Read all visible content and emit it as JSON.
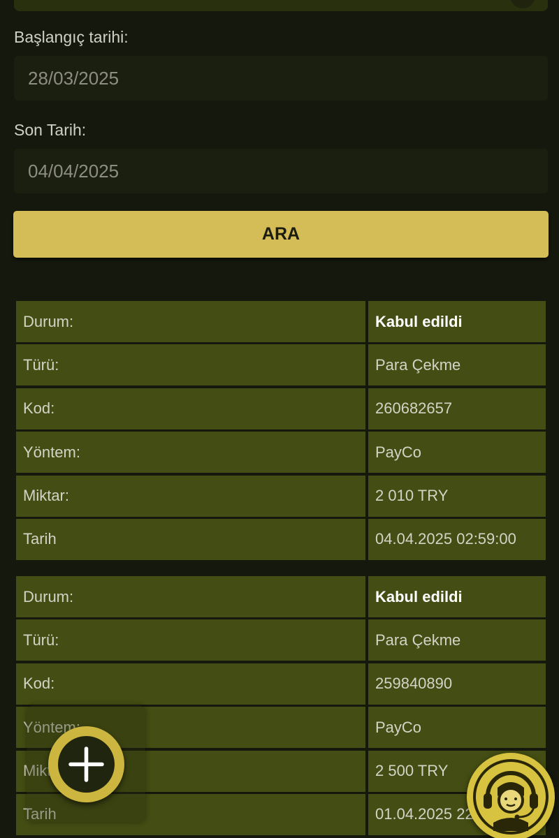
{
  "filters": {
    "start_label": "Başlangıç tarihi:",
    "start_value": "28/03/2025",
    "end_label": "Son Tarih:",
    "end_value": "04/04/2025",
    "search_label": "ARA"
  },
  "transactions": [
    {
      "rows": [
        {
          "label": "Durum:",
          "value": "Kabul edildi"
        },
        {
          "label": "Türü:",
          "value": "Para Çekme"
        },
        {
          "label": "Kod:",
          "value": "260682657"
        },
        {
          "label": "Yöntem:",
          "value": "PayCo"
        },
        {
          "label": "Miktar:",
          "value": "2 010 TRY"
        },
        {
          "label": "Tarih",
          "value": "04.04.2025 02:59:00"
        }
      ]
    },
    {
      "rows": [
        {
          "label": "Durum:",
          "value": "Kabul edildi"
        },
        {
          "label": "Türü:",
          "value": "Para Çekme"
        },
        {
          "label": "Kod:",
          "value": "259840890"
        },
        {
          "label": "Yöntem:",
          "value": "PayCo"
        },
        {
          "label": "Miktar:",
          "value": "2 500 TRY"
        },
        {
          "label": "Tarih",
          "value": "01.04.2025 22"
        }
      ]
    }
  ],
  "icons": {
    "fab": "plus-icon",
    "support": "headset-icon",
    "dropdown": "chevron-down-icon"
  },
  "colors": {
    "background": "#15180d",
    "button": "#d4bc56",
    "table_cell": "#444d13",
    "accent": "#cdb63f"
  }
}
